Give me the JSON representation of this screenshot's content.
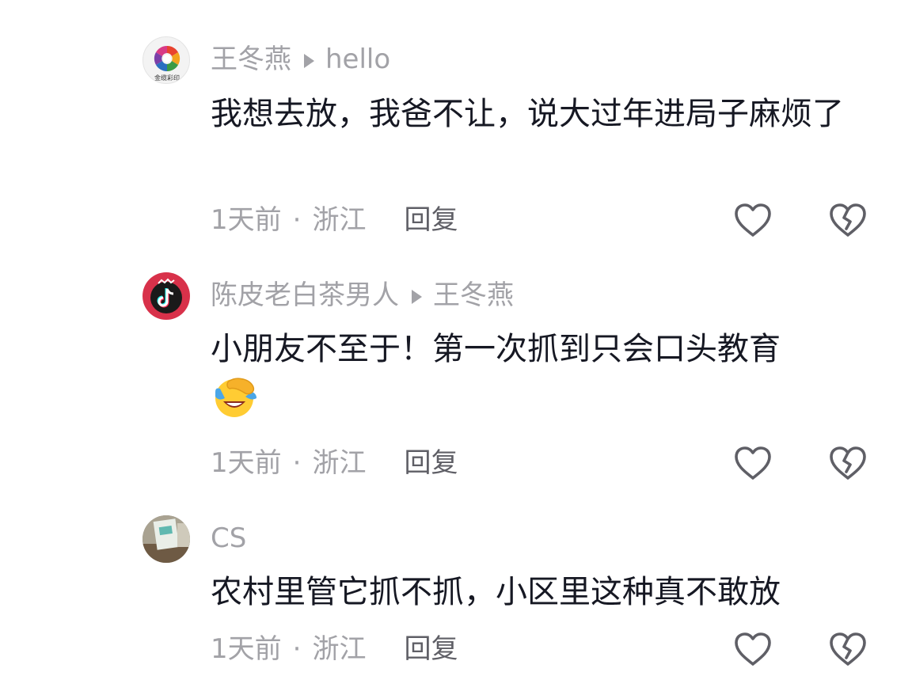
{
  "comments": [
    {
      "avatar_icon": "colorful-logo-avatar",
      "avatar_text": "金缆彩印",
      "username": "王冬燕",
      "reply_to": "hello",
      "text": "我想去放，我爸不让，说大过年进局子麻烦了",
      "time": "1天前",
      "location": "浙江",
      "reply_label": "回复"
    },
    {
      "avatar_icon": "tiktok-logo-avatar",
      "username": "陈皮老白茶男人",
      "reply_to": "王冬燕",
      "text": "小朋友不至于！第一次抓到只会口头教育",
      "emoji": "facepalm-laughing-emoji",
      "time": "1天前",
      "location": "浙江",
      "reply_label": "回复"
    },
    {
      "avatar_icon": "photo-avatar",
      "username": "CS",
      "text": "农村里管它抓不抓，小区里这种真不敢放",
      "time": "1天前",
      "location": "浙江",
      "reply_label": "回复"
    }
  ],
  "icons": {
    "like": "heart-outline-icon",
    "dislike": "broken-heart-icon"
  },
  "colors": {
    "text_primary": "#161823",
    "text_secondary": "#a2a2a7",
    "reply_label": "#5f5f66"
  }
}
